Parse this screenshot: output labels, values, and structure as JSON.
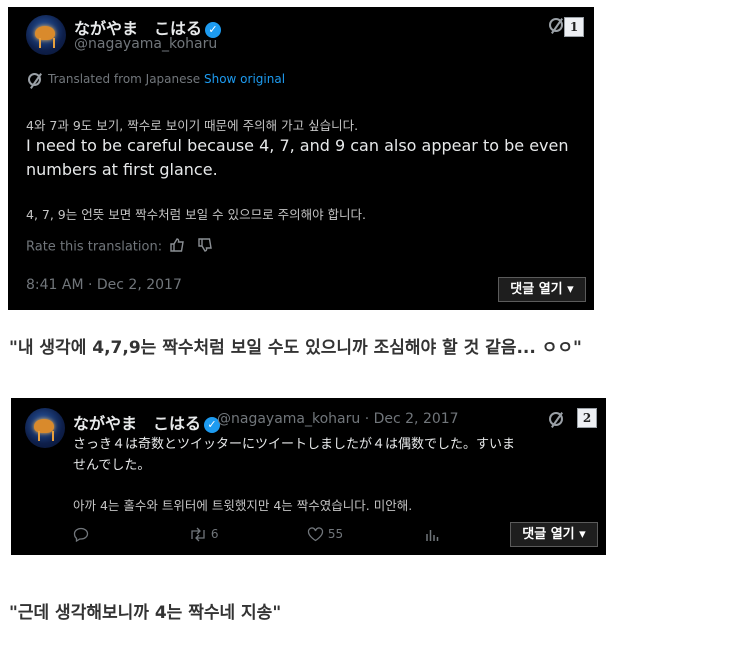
{
  "post1": {
    "display_name": "ながやま　こはる",
    "handle": "@nagayama_koharu",
    "badge": "1",
    "translated_from": "Translated from Japanese",
    "show_original": "Show original",
    "korean_line1": "4와 7과 9도 보기, 짝수로 보이기 때문에 주의해 가고 싶습니다.",
    "english_line1": "I need to be careful because 4, 7, and 9 can also appear to be even",
    "english_line2": "numbers at first glance.",
    "korean_line2": "4, 7, 9는 언뜻 보면 짝수처럼 보일 수 있으므로 주의해야 합니다.",
    "rate": "Rate this translation:",
    "timestamp": "8:41 AM · Dec 2, 2017",
    "comments_button": "댓글 열기 ▾"
  },
  "caption1": "\"내 생각에 4,7,9는 짝수처럼 보일 수도 있으니까 조심해야 할 것 같음... ㅇㅇ\"",
  "post2": {
    "display_name": "ながやま　こはる",
    "handle_date": "@nagayama_koharu · Dec 2, 2017",
    "badge": "2",
    "jp_line1": "さっき４は奇数とツイッターにツイートしましたが４は偶数でした。すいま",
    "jp_line2": "せんでした。",
    "korean": "아까 4는 홀수와 트위터에 트윗했지만 4는 짝수였습니다. 미안해.",
    "retweets": "6",
    "likes": "55",
    "comments_button": "댓글 열기 ▾"
  },
  "caption2": "\"근데 생각해보니까 4는 짝수네 지송\""
}
